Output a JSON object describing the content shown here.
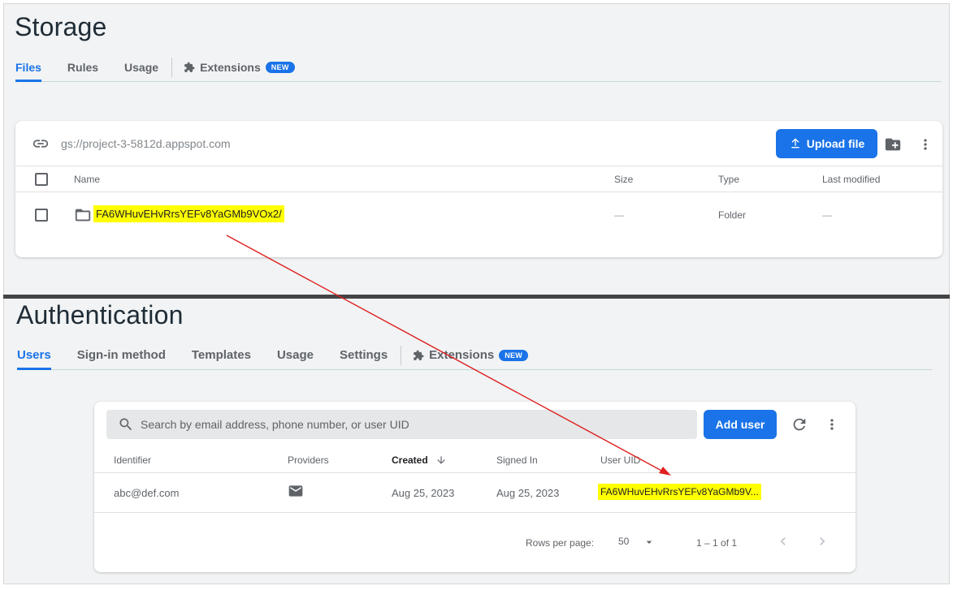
{
  "storage": {
    "title": "Storage",
    "tabs": [
      {
        "label": "Files",
        "active": true
      },
      {
        "label": "Rules"
      },
      {
        "label": "Usage"
      }
    ],
    "extensions_tab": {
      "label": "Extensions",
      "badge": "NEW"
    },
    "bucket_url": "gs://project-3-5812d.appspot.com",
    "upload_label": "Upload file",
    "columns": {
      "name": "Name",
      "size": "Size",
      "type": "Type",
      "last_modified": "Last modified"
    },
    "rows": [
      {
        "name": "FA6WHuvEHvRrsYEFv8YaGMb9VOx2/",
        "size": "—",
        "type": "Folder",
        "last_modified": "—"
      }
    ]
  },
  "auth": {
    "title": "Authentication",
    "tabs": [
      {
        "label": "Users",
        "active": true
      },
      {
        "label": "Sign-in method"
      },
      {
        "label": "Templates"
      },
      {
        "label": "Usage"
      },
      {
        "label": "Settings"
      }
    ],
    "extensions_tab": {
      "label": "Extensions",
      "badge": "NEW"
    },
    "search_placeholder": "Search by email address, phone number, or user UID",
    "add_user_label": "Add user",
    "columns": {
      "identifier": "Identifier",
      "providers": "Providers",
      "created": "Created",
      "signed_in": "Signed In",
      "user_uid": "User UID"
    },
    "rows": [
      {
        "identifier": "abc@def.com",
        "provider_icon": "email-icon",
        "created": "Aug 25, 2023",
        "signed_in": "Aug 25, 2023",
        "user_uid": "FA6WHuvEHvRrsYEFv8YaGMb9V..."
      }
    ],
    "pagination": {
      "rows_per_page_label": "Rows per page:",
      "rows_per_page": "50",
      "range": "1 – 1 of 1"
    }
  },
  "colors": {
    "accent": "#1a73e8",
    "highlight": "#ffff00",
    "annotation_arrow": "#e02020",
    "page_bg": "#f1f3f4"
  }
}
